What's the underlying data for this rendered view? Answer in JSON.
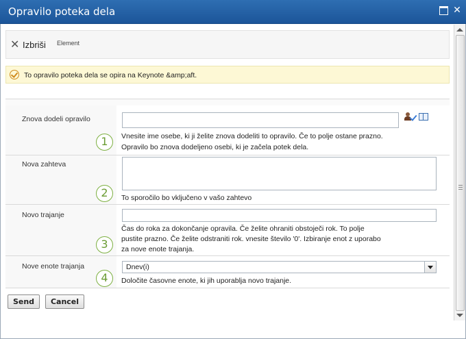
{
  "window": {
    "title": "Opravilo poteka dela"
  },
  "ribbon": {
    "delete_label": "Izbriši",
    "element_label": "Element"
  },
  "notice": {
    "text": "To opravilo poteka dela se opira na Keynote &amp;aft."
  },
  "form": {
    "reassign": {
      "label": "Znova dodeli opravilo",
      "number": "1",
      "value": "",
      "desc_line1": "Vnesite ime osebe, ki ji želite znova dodeliti to opravilo. Če to polje ostane prazno.",
      "desc_line2": "Opravilo bo znova dodeljeno osebi, ki je začela potek dela."
    },
    "request": {
      "label": "Nova zahteva",
      "number": "2",
      "value": "",
      "desc": "To sporočilo bo vključeno v vašo zahtevo"
    },
    "duration": {
      "label": "Novo trajanje",
      "number": "3",
      "value": "",
      "desc_line1": "Čas do roka za dokončanje opravila. Če želite ohraniti obstoječi rok. To polje",
      "desc_line2": "pustite prazno. Če želite odstraniti rok. vnesite število '0'. Izbiranje enot z uporabo",
      "desc_line3": "za nove enote trajanja."
    },
    "units": {
      "label": "Nove enote trajanja",
      "number": "4",
      "selected": "Dnev(i)",
      "desc": "Določite časovne enote, ki jih uporablja novo trajanje."
    }
  },
  "buttons": {
    "send": "Send",
    "cancel": "Cancel"
  },
  "colors": {
    "titlebar": "#2e6eb2",
    "notice_bg": "#fdf8d5",
    "step_circle": "#7db041"
  }
}
